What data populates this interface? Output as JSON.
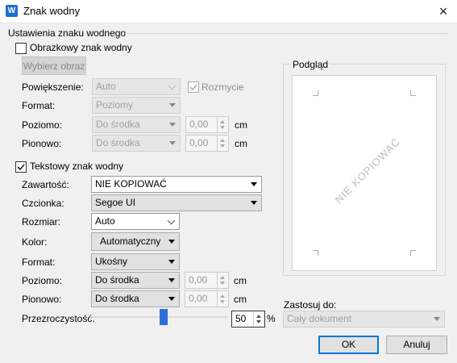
{
  "window": {
    "title": "Znak wodny",
    "close_icon": "×"
  },
  "group_title": "Ustawienia znaku wodnego",
  "image_wm": {
    "checkbox_label": "Obrazkowy znak wodny",
    "checked": false,
    "choose_button": "Wybierz obraz",
    "scale_label": "Powiększenie:",
    "scale_value": "Auto",
    "blur_label": "Rozmycie",
    "format_label": "Format:",
    "format_value": "Poziomy",
    "horizontal_label": "Poziomo:",
    "horizontal_value": "Do środka",
    "horizontal_offset": "0,00",
    "vertical_label": "Pionowo:",
    "vertical_value": "Do środka",
    "vertical_offset": "0,00",
    "unit": "cm"
  },
  "text_wm": {
    "checkbox_label": "Tekstowy znak wodny",
    "checked": true,
    "content_label": "Zawartość:",
    "content_value": "NIE KOPIOWAĆ",
    "font_label": "Czcionka:",
    "font_value": "Segoe UI",
    "size_label": "Rozmiar:",
    "size_value": "Auto",
    "color_label": "Kolor:",
    "color_value": "Automatyczny",
    "format_label": "Format:",
    "format_value": "Ukośny",
    "horizontal_label": "Poziomo:",
    "horizontal_value": "Do środka",
    "horizontal_offset": "0,00",
    "vertical_label": "Pionowo:",
    "vertical_value": "Do środka",
    "vertical_offset": "0,00",
    "unit": "cm",
    "transparency_label": "Przezroczystość:",
    "transparency_value": "50",
    "transparency_unit": "%",
    "transparency_level": 0.5
  },
  "preview": {
    "label": "Podgląd",
    "watermark_text": "NIE KOPIOWAĆ"
  },
  "apply_to": {
    "label": "Zastosuj do:",
    "value": "Cały dokument"
  },
  "buttons": {
    "ok": "OK",
    "cancel": "Anuluj"
  }
}
